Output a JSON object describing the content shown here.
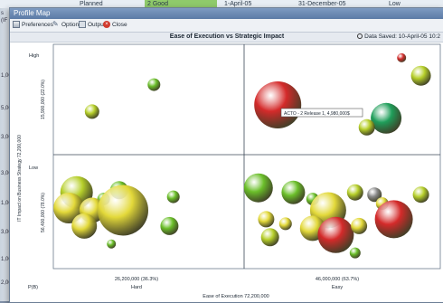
{
  "background": {
    "row_cells": [
      "Planned",
      "2 Good",
      "1-April-05",
      "31-December-05",
      "Low"
    ],
    "left_text": [
      "s",
      "(IF",
      "1,00",
      "5,00",
      "3,00",
      "3,00",
      "1,00",
      "3,00",
      "1,00",
      "2,00"
    ]
  },
  "window": {
    "title": "Profile Map",
    "toolbar": {
      "preferences": "Preferences",
      "options": "Options",
      "output": "Output",
      "close": "Close"
    }
  },
  "chart_title": "Ease of Execution vs Strategic Impact",
  "data_saved": "Data Saved: 10-April-05 10:2",
  "colors": {
    "accent": "#5c7ba6",
    "green": "#6bbf2a",
    "yellow_green": "#b6cf2a",
    "yellow": "#e3d93a",
    "red": "#d42a2a",
    "dark_green": "#1f9e5a",
    "gray": "#8a8a8a"
  },
  "chart_data": {
    "type": "scatter",
    "title": "Ease of Execution vs Strategic Impact",
    "xlabel": "Ease of Execution 72,200,000",
    "ylabel": "IT Impact on Business Strategy 72,200,000",
    "quadrant_labels_x": [
      "Hard",
      "Easy"
    ],
    "quadrant_labels_y": [
      "High",
      "Low"
    ],
    "x_ticks": [
      {
        "label": "26,200,000 (36.3%)"
      },
      {
        "label": "46,000,000 (63.7%)"
      }
    ],
    "y_ticks": [
      {
        "label": "15,900,000 (22.0%)"
      },
      {
        "label": "56,400,000 (78.0%)"
      }
    ],
    "tooltip": "ACTO - 2 Release 1, 4,980,000$",
    "footer_label": "P(B)",
    "bubbles": [
      {
        "x": 0.26,
        "y": 0.82,
        "size": 7,
        "color": "green"
      },
      {
        "x": 0.1,
        "y": 0.7,
        "size": 8,
        "color": "yellow_green"
      },
      {
        "x": 0.06,
        "y": 0.34,
        "size": 18,
        "color": "yellow_green"
      },
      {
        "x": 0.17,
        "y": 0.35,
        "size": 10,
        "color": "green"
      },
      {
        "x": 0.13,
        "y": 0.31,
        "size": 7,
        "color": "green"
      },
      {
        "x": 0.04,
        "y": 0.27,
        "size": 17,
        "color": "yellow"
      },
      {
        "x": 0.1,
        "y": 0.26,
        "size": 14,
        "color": "yellow"
      },
      {
        "x": 0.18,
        "y": 0.26,
        "size": 28,
        "color": "yellow"
      },
      {
        "x": 0.08,
        "y": 0.19,
        "size": 14,
        "color": "yellow"
      },
      {
        "x": 0.31,
        "y": 0.32,
        "size": 7,
        "color": "green"
      },
      {
        "x": 0.3,
        "y": 0.19,
        "size": 10,
        "color": "green"
      },
      {
        "x": 0.15,
        "y": 0.11,
        "size": 5,
        "color": "green"
      },
      {
        "x": 0.58,
        "y": 0.73,
        "size": 26,
        "color": "red"
      },
      {
        "x": 0.86,
        "y": 0.67,
        "size": 17,
        "color": "dark_green"
      },
      {
        "x": 0.81,
        "y": 0.63,
        "size": 9,
        "color": "yellow_green"
      },
      {
        "x": 0.9,
        "y": 0.94,
        "size": 5,
        "color": "red"
      },
      {
        "x": 0.95,
        "y": 0.86,
        "size": 11,
        "color": "yellow_green"
      },
      {
        "x": 0.53,
        "y": 0.36,
        "size": 16,
        "color": "green"
      },
      {
        "x": 0.62,
        "y": 0.34,
        "size": 13,
        "color": "green"
      },
      {
        "x": 0.67,
        "y": 0.31,
        "size": 7,
        "color": "green"
      },
      {
        "x": 0.71,
        "y": 0.26,
        "size": 20,
        "color": "yellow"
      },
      {
        "x": 0.78,
        "y": 0.34,
        "size": 9,
        "color": "yellow_green"
      },
      {
        "x": 0.83,
        "y": 0.33,
        "size": 8,
        "color": "gray"
      },
      {
        "x": 0.85,
        "y": 0.29,
        "size": 7,
        "color": "yellow"
      },
      {
        "x": 0.88,
        "y": 0.22,
        "size": 21,
        "color": "red"
      },
      {
        "x": 0.95,
        "y": 0.33,
        "size": 9,
        "color": "yellow_green"
      },
      {
        "x": 0.55,
        "y": 0.22,
        "size": 9,
        "color": "yellow"
      },
      {
        "x": 0.6,
        "y": 0.2,
        "size": 7,
        "color": "yellow"
      },
      {
        "x": 0.67,
        "y": 0.18,
        "size": 14,
        "color": "yellow"
      },
      {
        "x": 0.73,
        "y": 0.15,
        "size": 20,
        "color": "red"
      },
      {
        "x": 0.79,
        "y": 0.19,
        "size": 9,
        "color": "yellow"
      },
      {
        "x": 0.56,
        "y": 0.14,
        "size": 10,
        "color": "yellow_green"
      },
      {
        "x": 0.78,
        "y": 0.07,
        "size": 6,
        "color": "green"
      }
    ]
  }
}
